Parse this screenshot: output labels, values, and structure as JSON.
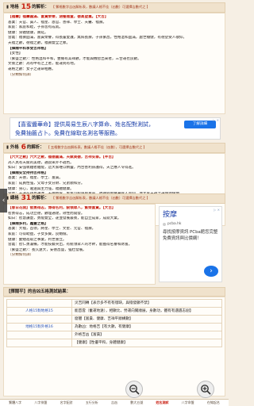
{
  "s15": {
    "g": "▮ 地格",
    "num": "15",
    "label": "的解析：",
    "note": "【 繁格數字吉凶解析表，數議人格不佳（凶數）可選擇吉數代之 】",
    "lines": [
      "【福壽】福壽圓滿、富貴榮譽，涵養雅量，德高望重。【大吉】",
      "基業：天官、貴人、福星、恩官、善祥、學士、天醫、福壽。",
      "家庭：家庭和睦，子孫皆有成就。",
      "健康：身體健康，壽延。",
      "含義：福壽圓滿，富貴榮譽，得長輩愛護，無病長壽，子孫繁昌，性格溫和圓滿，處世穩健，有德望受人敬仰。",
      "天福之數，德福之數，福壽雙全之象。",
      "【揮闊平和享受吉祥格】",
      "【女性】",
      "（繁盛之數）：性格溫和平和，豐擁有其祥數，才能與機智出來者，三合運也良數。",
      "文後之數：為有中有之上者，能運到有地。",
      "運格之數：女子之運命相應。",
      "（分類如何詳）"
    ]
  },
  "ad1": {
    "line1": "【喜蜜醬華命】提供周易生辰八字算命、姓名配對測試，",
    "line2": "免費抽籤占卜。免費在線取名測名等服務。",
    "button": "了解詳細",
    "close": "▷ ✕"
  },
  "s6": {
    "g": "▮ 外格",
    "num": "6",
    "label": "的解析：",
    "note": "【 五格數字吉凶解析表，數議人格不佳（凶數），可選擇吉數代之 】",
    "lines": [
      "【六大之數】六大之數，福德圓滿，天賦美德，吉祥安泰。【半吉】",
      "為人具有天賦的美德，通說來外不遜色。",
      "如日：安強執難者難能，這大家唯以精靈，內合善利孫護得，天之應人令得進。",
      "【揮闊安全持持吉祥格】",
      "基業：天德，福星、學士、富貴。",
      "家庭：成員性強，父母子女分財、兄弟順和分。",
      "健康：身心，遲送與主力強，福體健康。",
      "含義：天運在持具通達，天德益厚，生生可招遇到富貴，福德到處擁著受人景仰，並大家天祥之運時源保地。",
      "（繁盛之數）：女子等得大通，遇其好遇則，身宜發子。",
      "【大德雍壽宣同之格】安得天德，得有恆產之德。",
      "（繁盛之數）：性格溫和平和，豐擁有其祥數，才能與機智出來者。",
      "文後之數：為有中有之上者，能運到有地。",
      "運格之數：女子之運命相應。",
      "（分類如何詳）"
    ]
  },
  "s31": {
    "g": "▮ 總格",
    "num": "31",
    "label": "的解析：",
    "note": "【 繁格數字吉凶解析表，數議人格不佳（凶數）可選擇吉數代之 】",
    "lines": [
      "【春日花開】智勇得志，博得名利，統領眾人，繁榮富貴。【大吉】",
      "智勇得志，成功立德，數理通達，效性而開發。",
      "如日：智慧謙虛，勇能雙全，遂並發展最後，能自立成家，成就大業。",
      "【揮闊多利，鑫豐之格】",
      "基業：大福，首領，將星、學士、文星、元官、福壽。",
      "家庭：可得助益，子女多賢，良婚愉。",
      "健康：勤勉進取之事業，利世重立。",
      "含義：智仁勇兼備，才能技藝突出，有統領眾人的才幹，能獲得名譽和財富。",
      "（繁盛之數）：長久遠大，安德昌盛，強壯發展。",
      "（分類如何詳）"
    ]
  },
  "ad2": {
    "title": "按摩",
    "domain": "pcba.hk",
    "desc": "尋找按摩資訊 PCba館您完整免費資訊與比價網！",
    "cta": "›",
    "close": "▷ ✕"
  },
  "test": {
    "title": "【揮闊平】的吉凶五格測試結果：",
    "rows": [
      {
        "label": "",
        "value": "災吉同轉【表示多不有有殘缺，與殘發顯不禁】"
      },
      {
        "label": "人格15對地格15",
        "value": "能首雲（奮運地遠），相數比，勞運向關順展，身數功，體有有遇遇志創】"
      },
      {
        "label": "",
        "value": "窟體【富貴、健康、吉祥平順構數】"
      },
      {
        "label": "地格15對外格16",
        "value": "為數凶：地格吉【有大數，有健康】"
      },
      {
        "label": "",
        "value": "外格吉凶【富貴】"
      },
      {
        "label": "",
        "value": "【健康】【性優平和，身體健康】"
      }
    ]
  },
  "bottom_tabs": [
    "繁體八字",
    "八字排盤",
    "名字配對",
    "五行分析",
    "吉凶",
    "數大五號",
    "姓名測試",
    "八字命盤",
    "在線起名"
  ],
  "bottom_active": 6,
  "zoom": {
    "out": "−",
    "in": "+"
  },
  "nav_arrow": "‹"
}
